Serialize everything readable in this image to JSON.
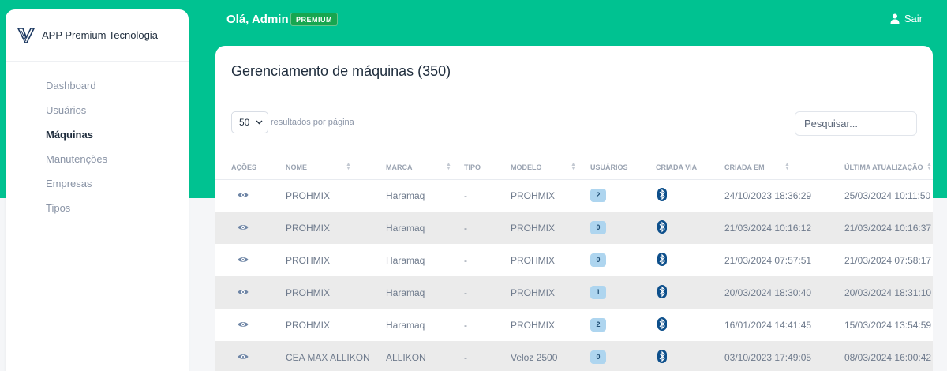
{
  "app": {
    "brand_name": "APP Premium Tecnologia"
  },
  "header": {
    "greeting": "Olá, Admin",
    "badge": "PREMIUM",
    "logout_label": "Sair"
  },
  "sidebar": {
    "items": [
      {
        "label": "Dashboard",
        "active": false
      },
      {
        "label": "Usuários",
        "active": false
      },
      {
        "label": "Máquinas",
        "active": true
      },
      {
        "label": "Manutenções",
        "active": false
      },
      {
        "label": "Empresas",
        "active": false
      },
      {
        "label": "Tipos",
        "active": false
      }
    ]
  },
  "main": {
    "title": "Gerenciamento de máquinas (350)",
    "page_size": "50",
    "page_size_label": "resultados por página",
    "search_placeholder": "Pesquisar...",
    "columns": [
      {
        "key": "acoes",
        "label": "AÇÕES",
        "sortable": false
      },
      {
        "key": "nome",
        "label": "NOME",
        "sortable": true
      },
      {
        "key": "marca",
        "label": "MARCA",
        "sortable": true
      },
      {
        "key": "tipo",
        "label": "TIPO",
        "sortable": false
      },
      {
        "key": "modelo",
        "label": "MODELO",
        "sortable": true
      },
      {
        "key": "usuarios",
        "label": "USUÁRIOS",
        "sortable": false
      },
      {
        "key": "criada_via",
        "label": "CRIADA VIA",
        "sortable": false
      },
      {
        "key": "criada_em",
        "label": "CRIADA EM",
        "sortable": true
      },
      {
        "key": "ultima",
        "label": "ÚLTIMA ATUALIZAÇÃO",
        "sortable": true
      }
    ],
    "rows": [
      {
        "acoes": "eye-icon",
        "nome": "PROHMIX",
        "marca": "Haramaq",
        "tipo": "-",
        "modelo": "PROHMIX",
        "usuarios": "2",
        "criada_via": "bluetooth-icon",
        "criada_em": "24/10/2023 18:36:29",
        "ultima": "25/03/2024 10:11:50"
      },
      {
        "acoes": "eye-icon",
        "nome": "PROHMIX",
        "marca": "Haramaq",
        "tipo": "-",
        "modelo": "PROHMIX",
        "usuarios": "0",
        "criada_via": "bluetooth-icon",
        "criada_em": "21/03/2024 10:16:12",
        "ultima": "21/03/2024 10:16:37"
      },
      {
        "acoes": "eye-icon",
        "nome": "PROHMIX",
        "marca": "Haramaq",
        "tipo": "-",
        "modelo": "PROHMIX",
        "usuarios": "0",
        "criada_via": "bluetooth-icon",
        "criada_em": "21/03/2024 07:57:51",
        "ultima": "21/03/2024 07:58:17"
      },
      {
        "acoes": "eye-icon",
        "nome": "PROHMIX",
        "marca": "Haramaq",
        "tipo": "-",
        "modelo": "PROHMIX",
        "usuarios": "1",
        "criada_via": "bluetooth-icon",
        "criada_em": "20/03/2024 18:30:40",
        "ultima": "20/03/2024 18:31:10"
      },
      {
        "acoes": "eye-icon",
        "nome": "PROHMIX",
        "marca": "Haramaq",
        "tipo": "-",
        "modelo": "PROHMIX",
        "usuarios": "2",
        "criada_via": "bluetooth-icon",
        "criada_em": "16/01/2024 14:41:45",
        "ultima": "15/03/2024 13:54:59"
      },
      {
        "acoes": "eye-icon",
        "nome": "CEA MAX ALLIKON",
        "marca": "ALLIKON",
        "tipo": "-",
        "modelo": "Veloz 2500",
        "usuarios": "0",
        "criada_via": "bluetooth-icon",
        "criada_em": "03/10/2023 17:49:05",
        "ultima": "08/03/2024 16:00:42"
      }
    ]
  },
  "colors": {
    "accent": "#00c291",
    "badge": "#17a650",
    "users_badge": "#aed5ef",
    "bluetooth": "#0d4f8b",
    "stripe": "#ebebeb"
  }
}
